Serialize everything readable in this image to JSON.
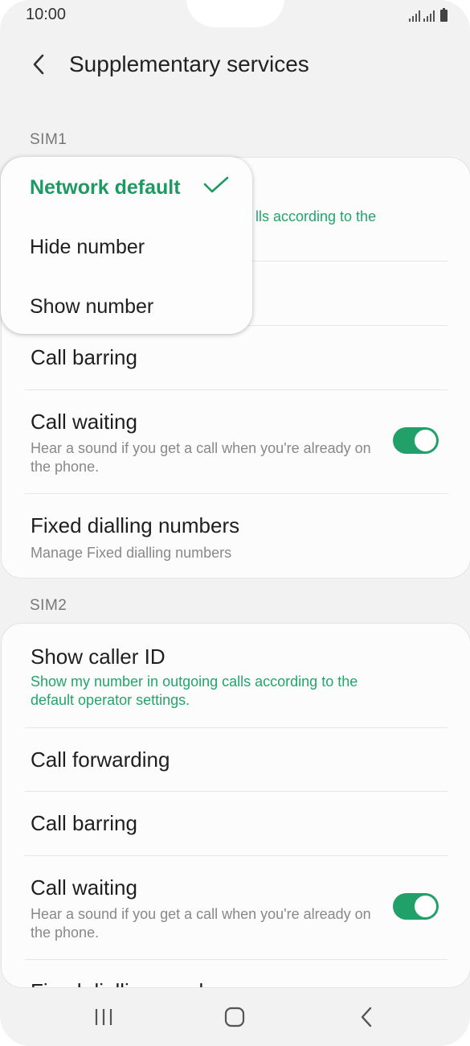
{
  "status_bar": {
    "time": "10:00",
    "icons": [
      "signal-icon",
      "signal-icon",
      "battery-icon"
    ]
  },
  "header": {
    "title": "Supplementary services",
    "back_icon": "chevron-left-icon"
  },
  "sim1": {
    "label": "SIM1",
    "partial_subtitle": "lls according to the",
    "items": [
      {
        "title": "Call barring"
      },
      {
        "title": "Call waiting",
        "subtitle": "Hear a sound if you get a call when you're already on the phone.",
        "toggle": "on"
      },
      {
        "title": "Fixed dialling numbers",
        "subtitle": "Manage Fixed dialling numbers"
      }
    ]
  },
  "caller_id_popup": {
    "options": [
      {
        "label": "Network default",
        "selected": true
      },
      {
        "label": "Hide number",
        "selected": false
      },
      {
        "label": "Show number",
        "selected": false
      }
    ],
    "check_icon": "check-icon"
  },
  "sim2": {
    "label": "SIM2",
    "items": [
      {
        "title": "Show caller ID",
        "subtitle": "Show my number in outgoing calls according to the default operator settings."
      },
      {
        "title": "Call forwarding"
      },
      {
        "title": "Call barring"
      },
      {
        "title": "Call waiting",
        "subtitle": "Hear a sound if you get a call when you're already on the phone.",
        "toggle": "on"
      },
      {
        "title": "Fixed dialling numbers"
      }
    ]
  },
  "colors": {
    "accent": "#22a06a",
    "background": "#f2f2f2",
    "card": "#fcfcfc"
  },
  "nav_bar": {
    "icons": [
      "recents-icon",
      "home-icon",
      "back-icon"
    ]
  }
}
